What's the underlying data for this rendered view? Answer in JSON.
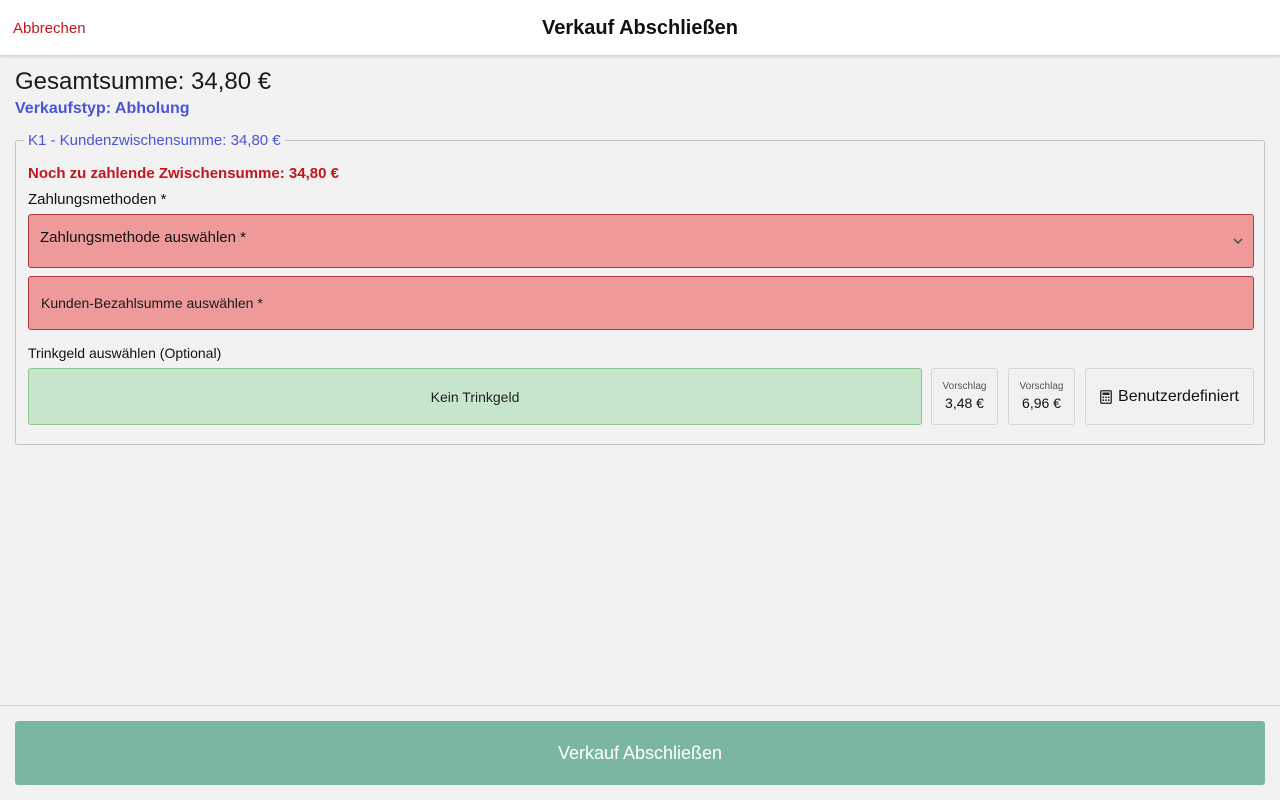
{
  "header": {
    "cancel_label": "Abbrechen",
    "title": "Verkauf Abschließen"
  },
  "summary": {
    "total": "Gesamtsumme: 34,80 €",
    "sale_type": "Verkaufstyp: Abholung"
  },
  "customer_group": {
    "legend": "K1 - Kundenzwischensumme: 34,80 €",
    "remaining": "Noch zu zahlende Zwischensumme: 34,80 €",
    "payment_methods_label": "Zahlungsmethoden *",
    "payment_method_select": {
      "value": "Zahlungsmethode auswählen *",
      "icon": "chevron-down-icon"
    },
    "amount_field": {
      "placeholder": "Kunden-Bezahlsumme auswählen *"
    },
    "tip": {
      "label": "Trinkgeld auswählen (Optional)",
      "none_label": "Kein Trinkgeld",
      "suggestions": [
        {
          "label": "Vorschlag",
          "value": "3,48 €"
        },
        {
          "label": "Vorschlag",
          "value": "6,96 €"
        }
      ],
      "custom_label": "Benutzerdefiniert",
      "custom_icon": "calculator-icon"
    }
  },
  "footer": {
    "finish_label": "Verkauf Abschließen"
  },
  "colors": {
    "accent": "#4a55d6",
    "error": "#c0161c",
    "error_field_bg": "#ee9a9a",
    "tip_selected_bg": "#c8e6cb",
    "primary_button_bg": "#7bb5a3"
  }
}
